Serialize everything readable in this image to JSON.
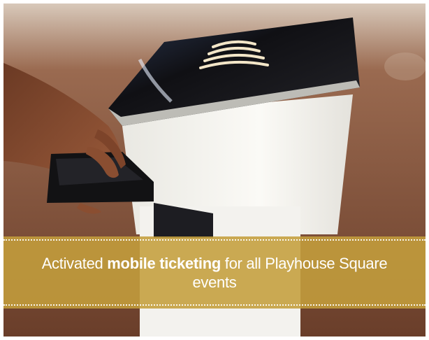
{
  "caption": {
    "before": "Activated ",
    "highlight": "mobile ticketing",
    "after": " for all Playhouse Square events"
  },
  "colors": {
    "banner": "#c49e3c",
    "floor": "#7a4a33",
    "kiosk_body": "#f2f1ec",
    "kiosk_top": "#1a1a1e",
    "wave_symbol": "#f3e6c8"
  },
  "scene": {
    "subject": "hand holding phone over ticket scanner kiosk",
    "icon": "contactless-wave-icon"
  }
}
